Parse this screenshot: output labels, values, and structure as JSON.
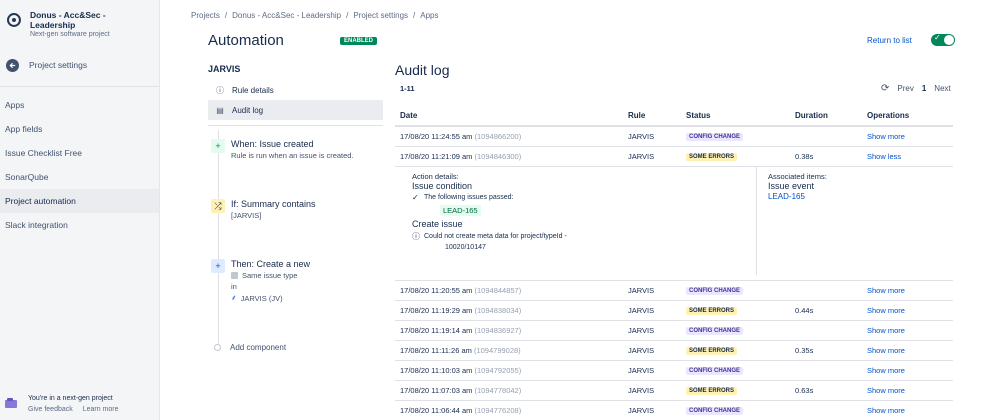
{
  "sidebar": {
    "project_name": "Donus - Acc&Sec - Leadership",
    "project_type": "Next-gen software project",
    "back_label": "Project settings",
    "items": [
      {
        "label": "Apps"
      },
      {
        "label": "App fields"
      },
      {
        "label": "Issue Checklist Free"
      },
      {
        "label": "SonarQube"
      },
      {
        "label": "Project automation"
      },
      {
        "label": "Slack integration"
      }
    ],
    "footer_title": "You're in a next-gen project",
    "footer_feedback": "Give feedback",
    "footer_learn": "Learn more"
  },
  "breadcrumb": [
    "Projects",
    "Donus - Acc&Sec - Leadership",
    "Project settings",
    "Apps"
  ],
  "header": {
    "title": "Automation",
    "badge": "ENABLED",
    "return_link": "Return to list",
    "toggle_on": true
  },
  "rule": {
    "name": "JARVIS",
    "nav": [
      {
        "label": "Rule details",
        "icon": "info-icon"
      },
      {
        "label": "Audit log",
        "icon": "list-icon"
      }
    ],
    "trigger_title": "When: Issue created",
    "trigger_sub": "Rule is run when an issue is created.",
    "condition_title": "If: Summary contains",
    "condition_sub": "[JARVIS]",
    "action_title": "Then: Create a new",
    "action_issue_type": "Same issue type",
    "action_in": "in",
    "action_project": "JARVIS (JV)",
    "add_component": "Add component"
  },
  "audit": {
    "title": "Audit log",
    "range": "1-11",
    "prev": "Prev",
    "page": "1",
    "next": "Next",
    "columns": [
      "Date",
      "Rule",
      "Status",
      "Duration",
      "Operations"
    ],
    "rows": [
      {
        "date": "17/08/20 11:24:55 am",
        "id": "(1094866200)",
        "rule": "JARVIS",
        "status": "CONFIG CHANGE",
        "status_kind": "config",
        "duration": "",
        "op": "Show more"
      },
      {
        "date": "17/08/20 11:21:09 am",
        "id": "(1094846300)",
        "rule": "JARVIS",
        "status": "SOME ERRORS",
        "status_kind": "errors",
        "duration": "0.38s",
        "op": "Show less"
      },
      {
        "date": "17/08/20 11:20:55 am",
        "id": "(1094844857)",
        "rule": "JARVIS",
        "status": "CONFIG CHANGE",
        "status_kind": "config",
        "duration": "",
        "op": "Show more"
      },
      {
        "date": "17/08/20 11:19:29 am",
        "id": "(1094838034)",
        "rule": "JARVIS",
        "status": "SOME ERRORS",
        "status_kind": "errors",
        "duration": "0.44s",
        "op": "Show more"
      },
      {
        "date": "17/08/20 11:19:14 am",
        "id": "(1094836927)",
        "rule": "JARVIS",
        "status": "CONFIG CHANGE",
        "status_kind": "config",
        "duration": "",
        "op": "Show more"
      },
      {
        "date": "17/08/20 11:11:26 am",
        "id": "(1094799028)",
        "rule": "JARVIS",
        "status": "SOME ERRORS",
        "status_kind": "errors",
        "duration": "0.35s",
        "op": "Show more"
      },
      {
        "date": "17/08/20 11:10:03 am",
        "id": "(1094792055)",
        "rule": "JARVIS",
        "status": "CONFIG CHANGE",
        "status_kind": "config",
        "duration": "",
        "op": "Show more"
      },
      {
        "date": "17/08/20 11:07:03 am",
        "id": "(1094778042)",
        "rule": "JARVIS",
        "status": "SOME ERRORS",
        "status_kind": "errors",
        "duration": "0.63s",
        "op": "Show more"
      },
      {
        "date": "17/08/20 11:06:44 am",
        "id": "(1094776208)",
        "rule": "JARVIS",
        "status": "CONFIG CHANGE",
        "status_kind": "config",
        "duration": "",
        "op": "Show more"
      }
    ],
    "detail": {
      "action_label": "Action details:",
      "condition_head": "Issue condition",
      "passed_text": "The following issues passed:",
      "passed_issue": "LEAD-165",
      "create_head": "Create issue",
      "error_line1": "Could not create meta data for project/typeId -",
      "error_line2": "10020/10147",
      "assoc_label": "Associated items:",
      "assoc_head": "Issue event",
      "assoc_link": "LEAD-165"
    }
  }
}
